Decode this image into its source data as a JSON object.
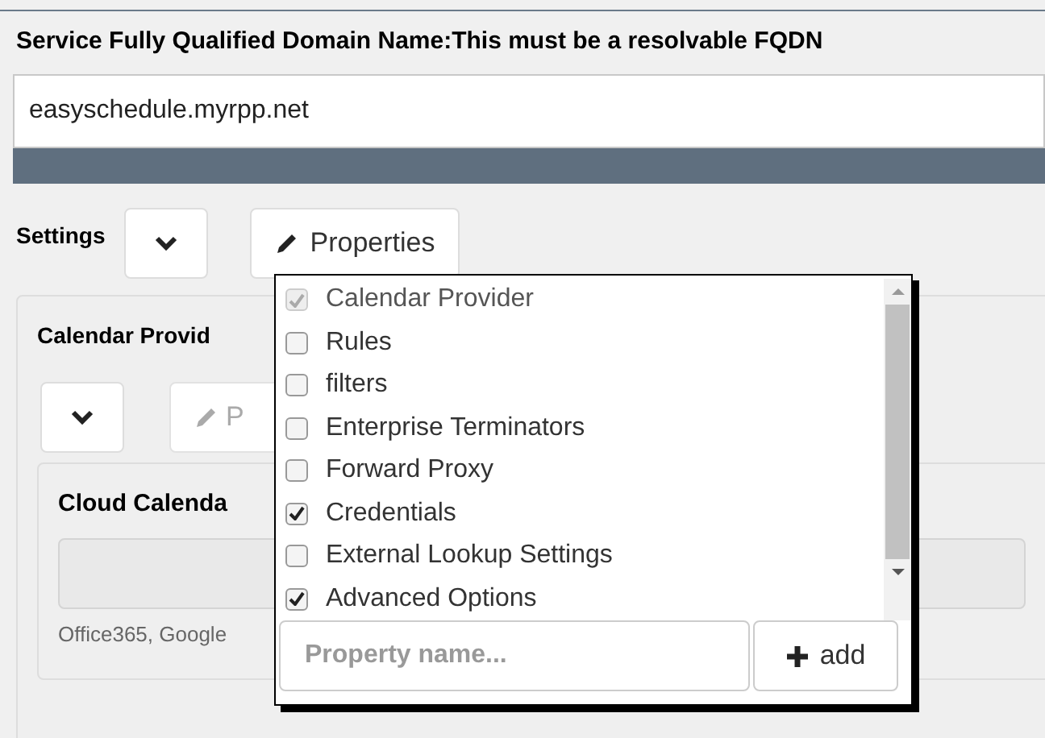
{
  "fqdn": {
    "label": "Service Fully Qualified Domain Name:",
    "hint": "This must be a resolvable FQDN",
    "value": "easyschedule.myrpp.net"
  },
  "settings": {
    "label": "Settings",
    "properties_button": "Properties"
  },
  "calendar_provider": {
    "title": "Calendar Provid",
    "properties_button": "P",
    "cloud_title": "Cloud Calenda",
    "help": "Office365, Google"
  },
  "properties_menu": {
    "items": [
      {
        "label": "Calendar Provider",
        "checked": true,
        "disabled": true
      },
      {
        "label": "Rules",
        "checked": false,
        "disabled": false
      },
      {
        "label": "filters",
        "checked": false,
        "disabled": false
      },
      {
        "label": "Enterprise Terminators",
        "checked": false,
        "disabled": false
      },
      {
        "label": "Forward Proxy",
        "checked": false,
        "disabled": false
      },
      {
        "label": "Credentials",
        "checked": true,
        "disabled": false
      },
      {
        "label": "External Lookup Settings",
        "checked": false,
        "disabled": false
      },
      {
        "label": "Advanced Options",
        "checked": true,
        "disabled": false
      }
    ],
    "placeholder": "Property name...",
    "add_button": "add"
  }
}
